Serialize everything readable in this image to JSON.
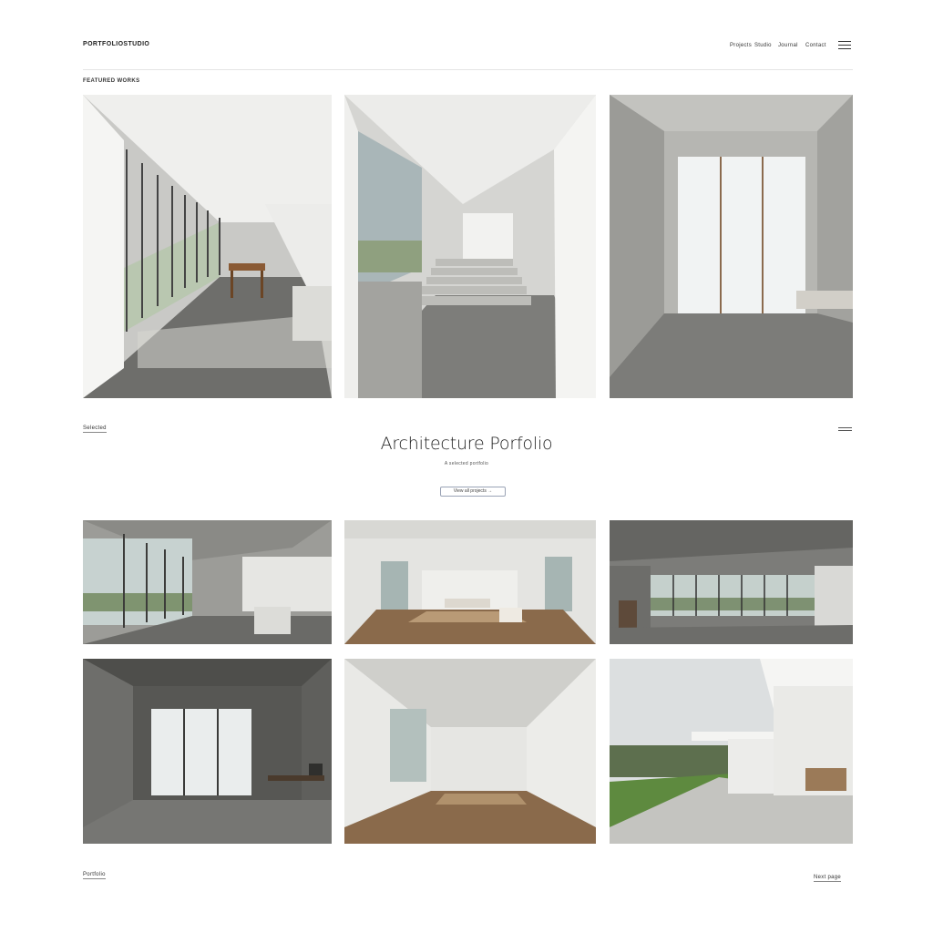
{
  "header": {
    "brand": "PORTFOLIOSTUDIO",
    "nav": [
      "Projects",
      "Studio",
      "Journal",
      "Contact"
    ],
    "menu_icon": "hamburger-menu-icon"
  },
  "section_label": "FEATURED WORKS",
  "middle": {
    "left_label": "Selected",
    "right_icon": "list-view-icon",
    "title": "Architecture Porfolio",
    "subtitle": "A selected portfolio",
    "cta": "View all projects →"
  },
  "footer": {
    "left_label": "Portfolio",
    "right_label": "Next page"
  },
  "colors": {
    "background": "#ffffff",
    "concrete": "#8f8f8c",
    "wall": "#e9e9e6",
    "wood": "#8a6a4b",
    "button_border": "#9aa3b5"
  },
  "photos": [
    "glass-corridor-interior",
    "stair-hall-interior",
    "frosted-window-concrete-room",
    "open-concrete-room",
    "wood-floor-white-hall",
    "panoramic-glass-concrete-room",
    "dark-concrete-room-frosted-window",
    "wood-floor-bright-room",
    "white-house-exterior-terrace"
  ]
}
